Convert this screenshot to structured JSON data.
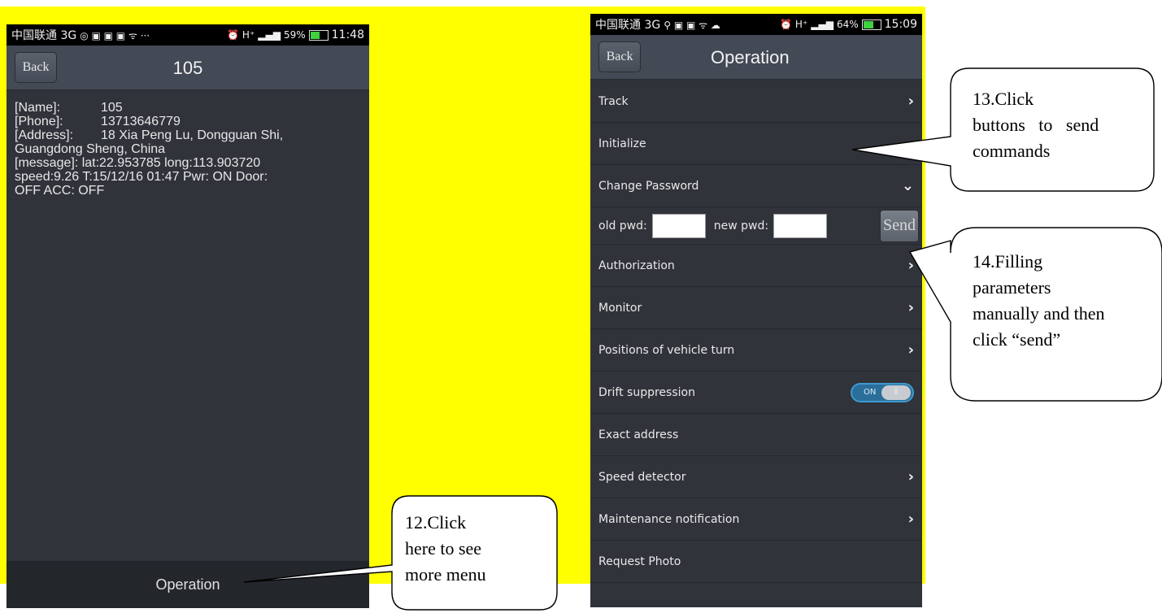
{
  "left_phone": {
    "status": {
      "carrier": "中国联通 3G",
      "signal": "H⁺",
      "battery": "59%",
      "battery_level": 0.59,
      "time": "11:48"
    },
    "back_label": "Back",
    "title": "105",
    "details": {
      "name_key": "[Name]:",
      "name_val": "105",
      "phone_key": "[Phone]:",
      "phone_val": "13713646779",
      "address_key": "[Address]:",
      "address_val": "18 Xia Peng Lu, Dongguan Shi,",
      "address_line2": "Guangdong Sheng, China",
      "message_line1": "[message]:  lat:22.953785 long:113.903720",
      "message_line2": "speed:9.26  T:15/12/16 01:47  Pwr: ON Door:",
      "message_line3": "OFF ACC: OFF"
    },
    "bottom_label": "Operation"
  },
  "right_phone": {
    "status": {
      "carrier": "中国联通 3G",
      "signal": "H⁺",
      "battery": "64%",
      "battery_level": 0.64,
      "time": "15:09"
    },
    "back_label": "Back",
    "title": "Operation",
    "menu": {
      "track": "Track",
      "initialize": "Initialize",
      "change_password": "Change Password",
      "old_pwd": "old pwd:",
      "new_pwd": "new pwd:",
      "send": "Send",
      "authorization": "Authorization",
      "monitor": "Monitor",
      "positions": "Positions of vehicle turn",
      "drift": "Drift suppression",
      "toggle_on": "ON",
      "exact_address": "Exact address",
      "speed_detector": "Speed detector",
      "maintenance": "Maintenance notification",
      "request_photo": "Request Photo"
    }
  },
  "callouts": {
    "c12": [
      "12.Click",
      "here to see",
      "more menu"
    ],
    "c13": [
      "13.Click",
      "buttons   to   send",
      "commands"
    ],
    "c14": [
      "14.Filling",
      "parameters",
      "manually and then",
      "click “send”"
    ]
  }
}
